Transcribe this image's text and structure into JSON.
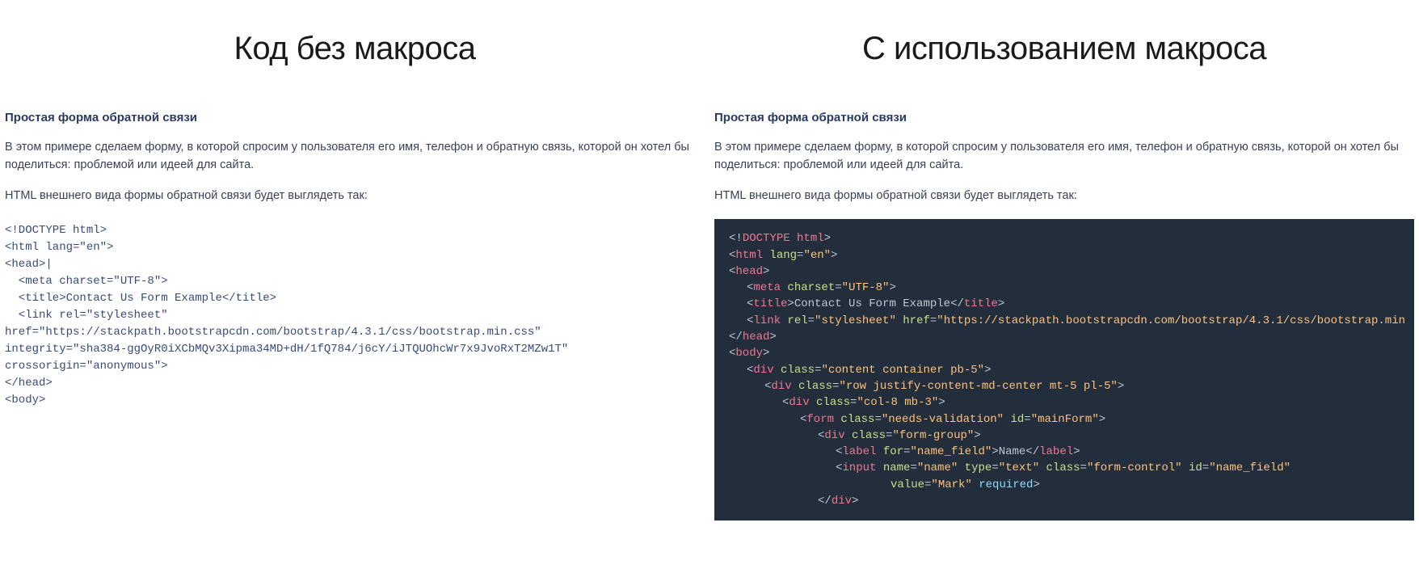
{
  "left": {
    "heading": "Код без макроса",
    "subtitle": "Простая форма обратной связи",
    "paragraph": "В этом примере сделаем форму, в которой спросим у пользователя его имя, телефон и обратную связь, которой он хотел бы поделиться: проблемой или идеей для сайта.",
    "html_line": "HTML внешнего вида формы обратной связи будет выглядеть так:",
    "code_lines": [
      "<!DOCTYPE html>",
      "<html lang=\"en\">",
      "<head>|",
      "  <meta charset=\"UTF-8\">",
      "  <title>Contact Us Form Example</title>",
      "  <link rel=\"stylesheet\"",
      "href=\"https://stackpath.bootstrapcdn.com/bootstrap/4.3.1/css/bootstrap.min.css\"",
      "integrity=\"sha384-ggOyR0iXCbMQv3Xipma34MD+dH/1fQ784/j6cY/iJTQUOhcWr7x9JvoRxT2MZw1T\"",
      "crossorigin=\"anonymous\">",
      "</head>",
      "<body>"
    ]
  },
  "right": {
    "heading": "С использованием макроса",
    "subtitle": "Простая форма обратной связи",
    "paragraph": "В этом примере сделаем форму, в которой спросим у пользователя его имя, телефон и обратную связь, которой он хотел бы поделиться: проблемой или идеей для сайта.",
    "html_line": "HTML внешнего вида формы обратной связи будет выглядеть так:",
    "code_tokens": [
      {
        "indent": 0,
        "tokens": [
          {
            "c": "p",
            "t": "<!"
          },
          {
            "c": "t",
            "t": "DOCTYPE html"
          },
          {
            "c": "p",
            "t": ">"
          }
        ]
      },
      {
        "indent": 0,
        "tokens": [
          {
            "c": "p",
            "t": "<"
          },
          {
            "c": "t",
            "t": "html"
          },
          {
            "c": "p",
            "t": " "
          },
          {
            "c": "a",
            "t": "lang"
          },
          {
            "c": "p",
            "t": "="
          },
          {
            "c": "v",
            "t": "\"en\""
          },
          {
            "c": "p",
            "t": ">"
          }
        ]
      },
      {
        "indent": 0,
        "tokens": [
          {
            "c": "p",
            "t": "<"
          },
          {
            "c": "t",
            "t": "head"
          },
          {
            "c": "p",
            "t": ">"
          }
        ]
      },
      {
        "indent": 1,
        "tokens": [
          {
            "c": "p",
            "t": "<"
          },
          {
            "c": "t",
            "t": "meta"
          },
          {
            "c": "p",
            "t": " "
          },
          {
            "c": "a",
            "t": "charset"
          },
          {
            "c": "p",
            "t": "="
          },
          {
            "c": "v",
            "t": "\"UTF-8\""
          },
          {
            "c": "p",
            "t": ">"
          }
        ]
      },
      {
        "indent": 1,
        "tokens": [
          {
            "c": "p",
            "t": "<"
          },
          {
            "c": "t",
            "t": "title"
          },
          {
            "c": "p",
            "t": ">"
          },
          {
            "c": "tx",
            "t": "Contact Us Form Example"
          },
          {
            "c": "p",
            "t": "</"
          },
          {
            "c": "t",
            "t": "title"
          },
          {
            "c": "p",
            "t": ">"
          }
        ]
      },
      {
        "indent": 1,
        "tokens": [
          {
            "c": "p",
            "t": "<"
          },
          {
            "c": "t",
            "t": "link"
          },
          {
            "c": "p",
            "t": " "
          },
          {
            "c": "a",
            "t": "rel"
          },
          {
            "c": "p",
            "t": "="
          },
          {
            "c": "v",
            "t": "\"stylesheet\""
          },
          {
            "c": "p",
            "t": " "
          },
          {
            "c": "a",
            "t": "href"
          },
          {
            "c": "p",
            "t": "="
          },
          {
            "c": "v",
            "t": "\"https://stackpath.bootstrapcdn.com/bootstrap/4.3.1/css/bootstrap.min"
          }
        ]
      },
      {
        "indent": 0,
        "tokens": [
          {
            "c": "p",
            "t": "</"
          },
          {
            "c": "t",
            "t": "head"
          },
          {
            "c": "p",
            "t": ">"
          }
        ]
      },
      {
        "indent": 0,
        "tokens": [
          {
            "c": "p",
            "t": "<"
          },
          {
            "c": "t",
            "t": "body"
          },
          {
            "c": "p",
            "t": ">"
          }
        ]
      },
      {
        "indent": 1,
        "tokens": [
          {
            "c": "p",
            "t": "<"
          },
          {
            "c": "t",
            "t": "div"
          },
          {
            "c": "p",
            "t": " "
          },
          {
            "c": "a",
            "t": "class"
          },
          {
            "c": "p",
            "t": "="
          },
          {
            "c": "v",
            "t": "\"content container pb-5\""
          },
          {
            "c": "p",
            "t": ">"
          }
        ]
      },
      {
        "indent": 2,
        "tokens": [
          {
            "c": "p",
            "t": "<"
          },
          {
            "c": "t",
            "t": "div"
          },
          {
            "c": "p",
            "t": " "
          },
          {
            "c": "a",
            "t": "class"
          },
          {
            "c": "p",
            "t": "="
          },
          {
            "c": "v",
            "t": "\"row justify-content-md-center mt-5 pl-5\""
          },
          {
            "c": "p",
            "t": ">"
          }
        ]
      },
      {
        "indent": 3,
        "tokens": [
          {
            "c": "p",
            "t": "<"
          },
          {
            "c": "t",
            "t": "div"
          },
          {
            "c": "p",
            "t": " "
          },
          {
            "c": "a",
            "t": "class"
          },
          {
            "c": "p",
            "t": "="
          },
          {
            "c": "v",
            "t": "\"col-8 mb-3\""
          },
          {
            "c": "p",
            "t": ">"
          }
        ]
      },
      {
        "indent": 4,
        "tokens": [
          {
            "c": "p",
            "t": "<"
          },
          {
            "c": "t",
            "t": "form"
          },
          {
            "c": "p",
            "t": " "
          },
          {
            "c": "a",
            "t": "class"
          },
          {
            "c": "p",
            "t": "="
          },
          {
            "c": "v",
            "t": "\"needs-validation\""
          },
          {
            "c": "p",
            "t": " "
          },
          {
            "c": "a",
            "t": "id"
          },
          {
            "c": "p",
            "t": "="
          },
          {
            "c": "v",
            "t": "\"mainForm\""
          },
          {
            "c": "p",
            "t": ">"
          }
        ]
      },
      {
        "indent": 5,
        "tokens": [
          {
            "c": "p",
            "t": "<"
          },
          {
            "c": "t",
            "t": "div"
          },
          {
            "c": "p",
            "t": " "
          },
          {
            "c": "a",
            "t": "class"
          },
          {
            "c": "p",
            "t": "="
          },
          {
            "c": "v",
            "t": "\"form-group\""
          },
          {
            "c": "p",
            "t": ">"
          }
        ]
      },
      {
        "indent": 6,
        "tokens": [
          {
            "c": "p",
            "t": "<"
          },
          {
            "c": "t",
            "t": "label"
          },
          {
            "c": "p",
            "t": " "
          },
          {
            "c": "a",
            "t": "for"
          },
          {
            "c": "p",
            "t": "="
          },
          {
            "c": "v",
            "t": "\"name_field\""
          },
          {
            "c": "p",
            "t": ">"
          },
          {
            "c": "tx",
            "t": "Name"
          },
          {
            "c": "p",
            "t": "</"
          },
          {
            "c": "t",
            "t": "label"
          },
          {
            "c": "p",
            "t": ">"
          }
        ]
      },
      {
        "indent": 6,
        "tokens": [
          {
            "c": "p",
            "t": "<"
          },
          {
            "c": "t",
            "t": "input"
          },
          {
            "c": "p",
            "t": " "
          },
          {
            "c": "a",
            "t": "name"
          },
          {
            "c": "p",
            "t": "="
          },
          {
            "c": "v",
            "t": "\"name\""
          },
          {
            "c": "p",
            "t": " "
          },
          {
            "c": "a",
            "t": "type"
          },
          {
            "c": "p",
            "t": "="
          },
          {
            "c": "v",
            "t": "\"text\""
          },
          {
            "c": "p",
            "t": " "
          },
          {
            "c": "a",
            "t": "class"
          },
          {
            "c": "p",
            "t": "="
          },
          {
            "c": "v",
            "t": "\"form-control\""
          },
          {
            "c": "p",
            "t": " "
          },
          {
            "c": "a",
            "t": "id"
          },
          {
            "c": "p",
            "t": "="
          },
          {
            "c": "v",
            "t": "\"name_field\""
          }
        ]
      },
      {
        "indent": 8,
        "tokens": [
          {
            "c": "a",
            "t": "value"
          },
          {
            "c": "p",
            "t": "="
          },
          {
            "c": "v",
            "t": "\"Mark\""
          },
          {
            "c": "p",
            "t": " "
          },
          {
            "c": "b",
            "t": "required"
          },
          {
            "c": "p",
            "t": ">"
          }
        ]
      },
      {
        "indent": 5,
        "tokens": [
          {
            "c": "p",
            "t": "</"
          },
          {
            "c": "t",
            "t": "div"
          },
          {
            "c": "p",
            "t": ">"
          }
        ]
      }
    ]
  }
}
